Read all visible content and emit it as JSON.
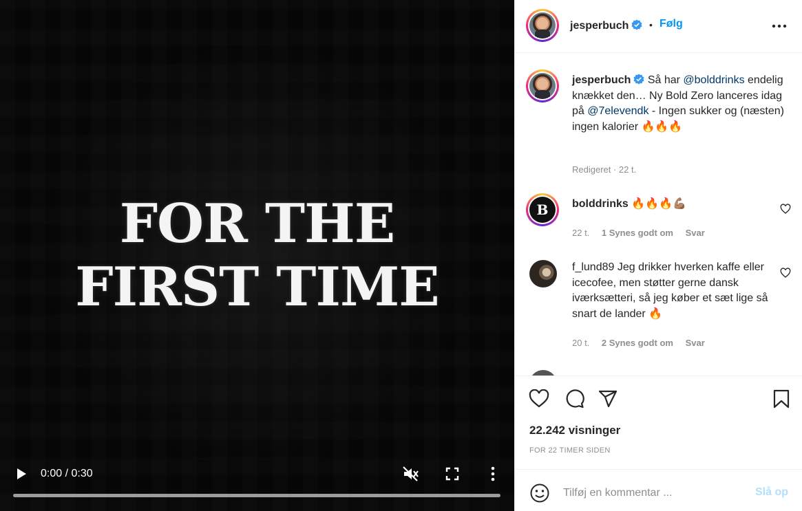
{
  "video": {
    "headline_line1": "FOR THE",
    "headline_line2": "FIRST TIME",
    "time": "0:00 / 0:30",
    "icons": [
      "play-icon",
      "muted-speaker-icon",
      "fullscreen-icon",
      "more-vertical-icon"
    ]
  },
  "header": {
    "username": "jesperbuch",
    "separator": "•",
    "follow_label": "Følg",
    "icons": [
      "verified-badge-icon",
      "more-horizontal-icon"
    ]
  },
  "caption": {
    "username": "jesperbuch",
    "text_1": "Så har ",
    "mention_1": "@bolddrinks",
    "text_2": " endelig knækket den… Ny Bold Zero lanceres idag på ",
    "mention_2": "@7elevendk",
    "text_3": " - Ingen sukker og (næsten) ingen kalorier 🔥🔥🔥",
    "meta": "Redigeret · 22 t."
  },
  "comments": [
    {
      "username": "bolddrinks",
      "avatar_letter": "B",
      "text": "🔥🔥🔥💪🏽",
      "time": "22 t.",
      "likes": "1 Synes godt om",
      "reply": "Svar"
    },
    {
      "username": "f_lund89",
      "text": "Jeg drikker hverken kaffe eller icecofee, men støtter gerne dansk iværksætteri, så jeg køber et sæt lige så snart de lander 🔥",
      "time": "20 t.",
      "likes": "2 Synes godt om",
      "reply": "Svar"
    }
  ],
  "actions": {
    "icons": [
      "heart-icon",
      "comment-icon",
      "share-icon",
      "bookmark-icon"
    ],
    "views": "22.242 visninger",
    "time_ago": "FOR 22 TIMER SIDEN"
  },
  "add_comment": {
    "placeholder": "Tilføj en kommentar ...",
    "post_label": "Slå op",
    "icon": "emoji-icon"
  },
  "colors": {
    "accent": "#0095f6",
    "mention": "#00376b",
    "muted": "#8e8e8e",
    "post_disabled": "#b2dffc"
  }
}
